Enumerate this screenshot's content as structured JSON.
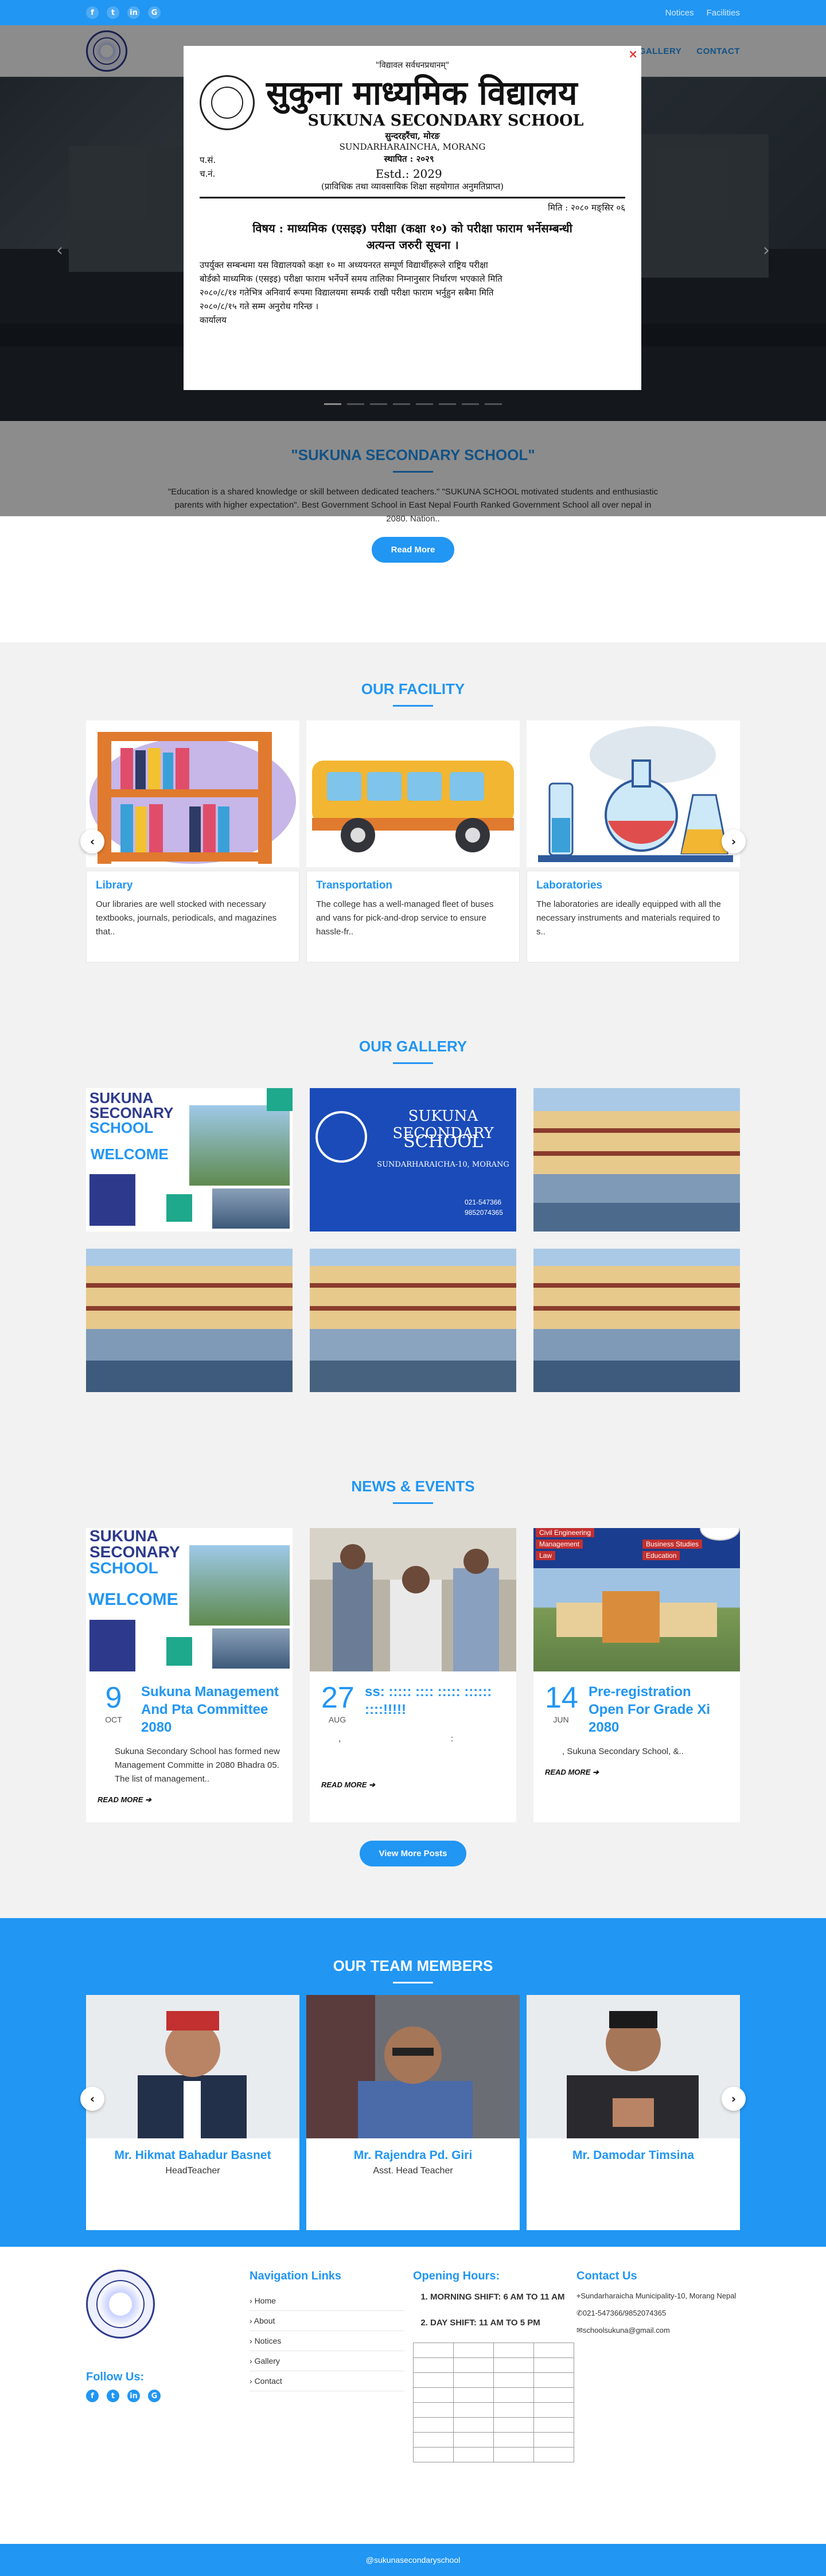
{
  "topbar": {
    "links": [
      "Notices",
      "Facilities"
    ]
  },
  "nav": {
    "items": [
      "GALLERY",
      "CONTACT"
    ]
  },
  "modal": {
    "top_line": "\"विद्यावल सर्वधनप्रधानम्\"",
    "title_ne": "सुकुना माध्यमिक विद्यालय",
    "title_en": "SUKUNA SECONDARY SCHOOL",
    "place_ne": "सुन्दरहरैंचा, मोरङ",
    "place_en": "SUNDARHARAINCHA, MORANG",
    "estd_ne": "स्थापित : २०२९",
    "estd_en": "Estd.: 2029",
    "note_ne": "(प्राविधिक तथा व्यावसायिक शिक्षा सहयोगात अनुमतिप्राप्त)",
    "ref1": "प.सं.",
    "ref2": "च.नं.",
    "date": "मिति : २०८० मङ्सिर ०६",
    "subject": "विषय : माध्यमिक (एसइइ) परीक्षा (कक्षा १०) को परीक्षा फाराम भर्नेसम्बन्धी",
    "subject2": "अत्यन्त जरुरी सूचना ।",
    "body": [
      "उपर्युक्त सम्बन्धमा यस विद्यालयको कक्षा १० मा अध्ययनरत सम्पूर्ण विद्यार्थीहरूले राष्ट्रिय परीक्षा",
      "बोर्डको माध्यमिक (एसइइ) परीक्षा फाराम भर्नेपर्ने समय तालिका निम्नानुसार निर्धारण भएकाले मिति",
      "२०८०/८/१४ गतेभित्र अनिवार्य रूपमा विद्यालयमा सम्पर्क राखी परीक्षा फाराम भर्नुहुन सबैमा मिति",
      "२०८०/८/१५ गते सम्म अनुरोध गरिन्छ ।"
    ],
    "sign": "कार्यालय",
    "close": "×"
  },
  "intro": {
    "title": "\"SUKUNA SECONDARY SCHOOL\"",
    "text": "\"Education is a shared knowledge or skill between dedicated teachers.\" \"SUKUNA SCHOOL motivated students and enthusiastic parents with higher expectation\". Best Government School in East Nepal  Fourth Ranked Government School all over nepal in 2080. Nation..",
    "button": "Read More"
  },
  "facility": {
    "title": "OUR FACILITY",
    "cards": [
      {
        "title": "Library",
        "text": "Our libraries are well stocked with necessary textbooks, journals, periodicals, and magazines that.."
      },
      {
        "title": "Transportation",
        "text": "The college has a well-managed fleet of buses and vans for pick-and-drop service to ensure hassle-fr.."
      },
      {
        "title": "Laboratories",
        "text": "The laboratories are ideally equipped with all the necessary instruments and materials required to s.."
      }
    ]
  },
  "gallery": {
    "title": "OUR GALLERY",
    "g1": {
      "a": "SUKUNA",
      "b": "SECONARY",
      "c": "SCHOOL",
      "welcome": "WELCOME"
    },
    "g2": {
      "a": "SUKUNA SECONDARY",
      "b": "SCHOOL",
      "c": "SUNDARHARAICHA-10, MORANG",
      "p1": "021-547366",
      "p2": "9852074365"
    }
  },
  "news": {
    "title": "NEWS & EVENTS",
    "cards": [
      {
        "day": "9",
        "month": "OCT",
        "title": "Sukuna Management And Pta Committee 2080",
        "text": "Sukuna Secondary School has formed new Management Committe in 2080 Bhadra 05. The list of management..",
        "read": "READ MORE ➔"
      },
      {
        "day": "27",
        "month": "AUG",
        "title": "ss: ::::: :::: ::::: :::::: ::::!!!!!",
        "text": ",                                              :",
        "read": "READ MORE ➔"
      },
      {
        "day": "14",
        "month": "JUN",
        "title": "Pre-registration Open For Grade Xi 2080",
        "text": ", Sukuna Secondary School, &..",
        "read": "READ MORE ➔"
      }
    ],
    "button": "View More Posts",
    "n3": {
      "l1": "Civil Engineering",
      "l2": "Management",
      "l3": "Business Studies",
      "l4": "Law",
      "l5": "Education"
    }
  },
  "team": {
    "title": "OUR TEAM MEMBERS",
    "members": [
      {
        "name": "Mr. Hikmat Bahadur Basnet",
        "role": "HeadTeacher"
      },
      {
        "name": "Mr. Rajendra Pd. Giri",
        "role": "Asst. Head Teacher"
      },
      {
        "name": "Mr. Damodar Timsina",
        "role": ""
      }
    ]
  },
  "footer": {
    "follow": "Follow Us:",
    "nav_title": "Navigation Links",
    "nav": [
      "Home",
      "About",
      "Notices",
      "Gallery",
      "Contact"
    ],
    "hours_title": "Opening Hours:",
    "hours": [
      "MORNING SHIFT: 6 AM TO 11 AM",
      "DAY SHIFT: 11 AM TO 5 PM"
    ],
    "contact_title": "Contact Us",
    "address": "Sundarharaicha Municipality-10, Morang Nepal",
    "phone": "021-547366/9852074365",
    "email": "schoolsukuna@gmail.com",
    "bottom": "@sukunasecondaryschool"
  },
  "colors": {
    "accent": "#2196f3",
    "close": "#e53935"
  }
}
